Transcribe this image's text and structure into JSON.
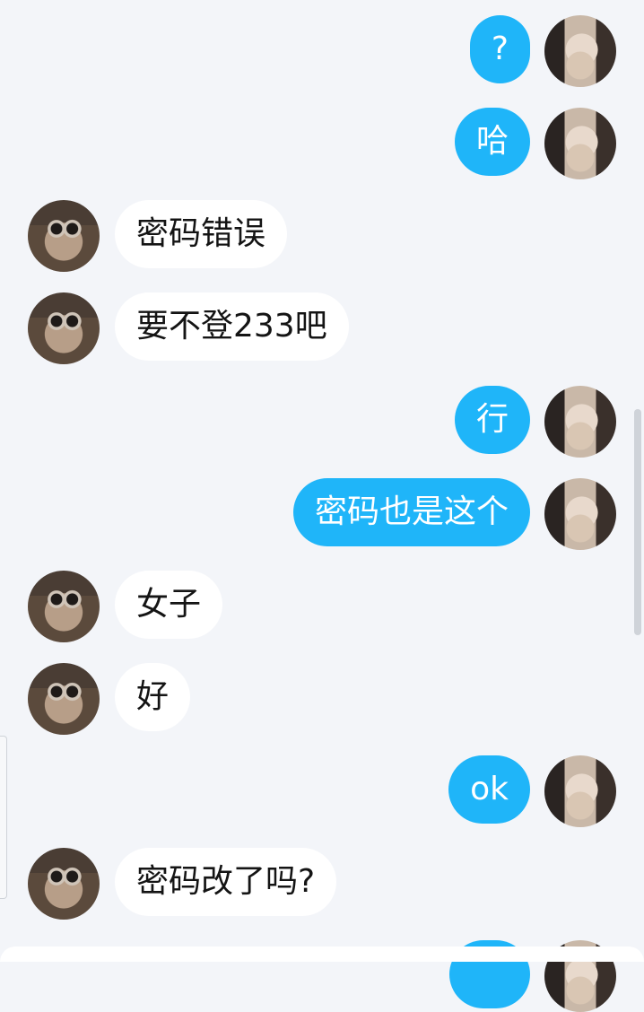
{
  "messages": [
    {
      "side": "out",
      "text": "?"
    },
    {
      "side": "out",
      "text": "哈"
    },
    {
      "side": "in",
      "text": "密码错误"
    },
    {
      "side": "in",
      "text": "要不登233吧"
    },
    {
      "side": "out",
      "text": "行"
    },
    {
      "side": "out",
      "text": "密码也是这个"
    },
    {
      "side": "in",
      "text": "女子"
    },
    {
      "side": "in",
      "text": "好"
    },
    {
      "side": "out",
      "text": "ok"
    },
    {
      "side": "in",
      "text": "密码改了吗?"
    },
    {
      "side": "out",
      "text": ""
    }
  ],
  "colors": {
    "background": "#f3f5f9",
    "outgoing_bubble": "#1fb5f9",
    "incoming_bubble": "#ffffff"
  }
}
